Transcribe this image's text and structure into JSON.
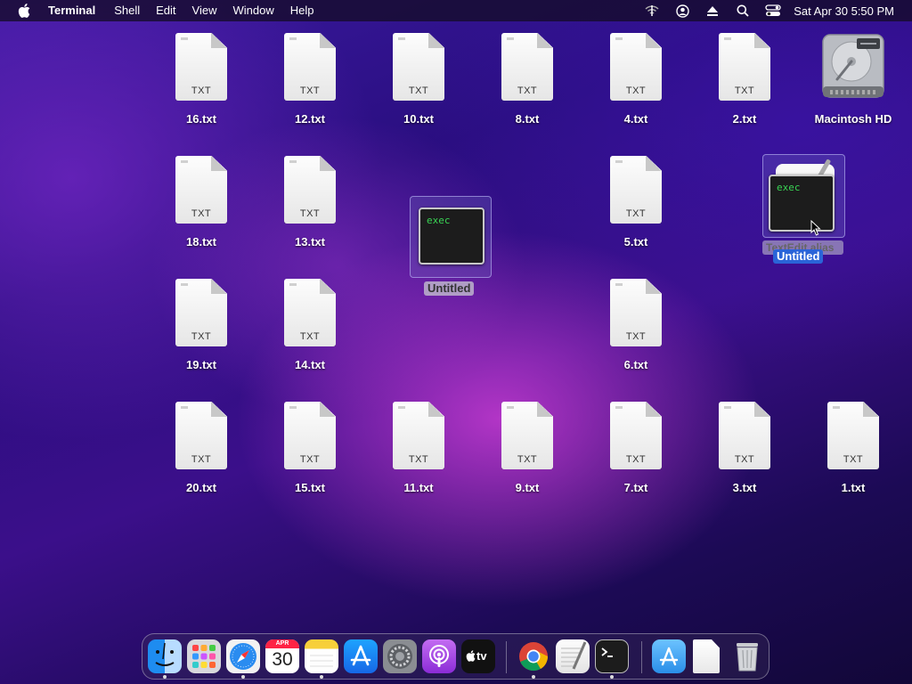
{
  "menubar": {
    "app_name": "Terminal",
    "menus": [
      "Shell",
      "Edit",
      "View",
      "Window",
      "Help"
    ],
    "clock": "Sat Apr 30  5:50 PM",
    "status_icons": [
      "wifi-off-icon",
      "user-icon",
      "eject-icon",
      "search-icon",
      "control-center-icon"
    ]
  },
  "desktop": {
    "files": [
      {
        "name": "16.txt",
        "ext": "TXT"
      },
      {
        "name": "12.txt",
        "ext": "TXT"
      },
      {
        "name": "10.txt",
        "ext": "TXT"
      },
      {
        "name": "8.txt",
        "ext": "TXT"
      },
      {
        "name": "4.txt",
        "ext": "TXT"
      },
      {
        "name": "2.txt",
        "ext": "TXT"
      },
      {
        "name": "18.txt",
        "ext": "TXT"
      },
      {
        "name": "13.txt",
        "ext": "TXT"
      },
      {
        "name": "5.txt",
        "ext": "TXT"
      },
      {
        "name": "19.txt",
        "ext": "TXT"
      },
      {
        "name": "14.txt",
        "ext": "TXT"
      },
      {
        "name": "6.txt",
        "ext": "TXT"
      },
      {
        "name": "20.txt",
        "ext": "TXT"
      },
      {
        "name": "15.txt",
        "ext": "TXT"
      },
      {
        "name": "11.txt",
        "ext": "TXT"
      },
      {
        "name": "9.txt",
        "ext": "TXT"
      },
      {
        "name": "7.txt",
        "ext": "TXT"
      },
      {
        "name": "3.txt",
        "ext": "TXT"
      },
      {
        "name": "1.txt",
        "ext": "TXT"
      }
    ],
    "disk": {
      "name": "Macintosh HD"
    },
    "exec_untitled": {
      "name": "Untitled",
      "badge": "exec"
    },
    "exec_dragged": {
      "badge": "exec",
      "under_label": "TextEdit alias",
      "label": "Untitled"
    }
  },
  "dock": {
    "calendar_month": "APR",
    "calendar_day": "30",
    "tv_label": "tv",
    "items": [
      "finder",
      "launchpad",
      "safari",
      "calendar",
      "notes",
      "app-store",
      "system-preferences",
      "podcasts",
      "apple-tv",
      "chrome",
      "textedit",
      "terminal",
      "applications-folder",
      "document",
      "trash"
    ]
  }
}
